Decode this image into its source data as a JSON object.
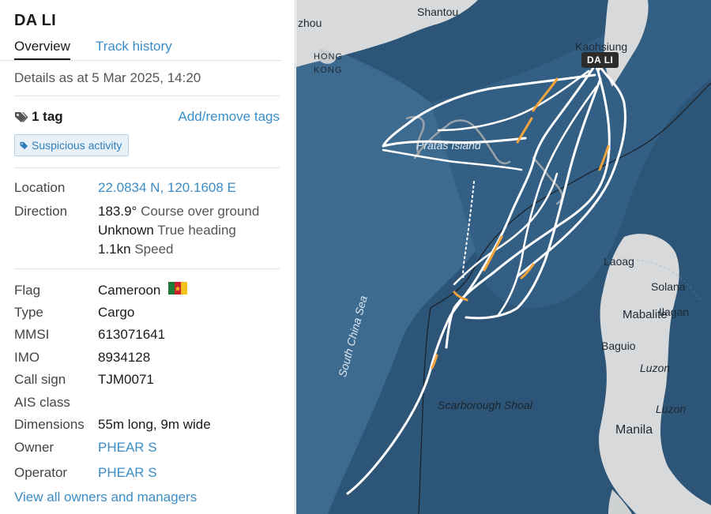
{
  "vessel": {
    "name": "DA LI"
  },
  "tabs": {
    "overview": "Overview",
    "track_history": "Track history"
  },
  "details_time": "Details as at 5 Mar 2025, 14:20",
  "tags": {
    "count_label": "1 tag",
    "add_remove_label": "Add/remove tags",
    "items": [
      "Suspicious activity"
    ]
  },
  "position": {
    "location_label": "Location",
    "location_value": "22.0834 N, 120.1608 E",
    "direction_label": "Direction",
    "course_value": "183.9°",
    "course_label": "Course over ground",
    "heading_value": "Unknown",
    "heading_label": "True heading",
    "speed_value": "1.1kn",
    "speed_label": "Speed"
  },
  "info": {
    "flag_label": "Flag",
    "flag_value": "Cameroon",
    "type_label": "Type",
    "type_value": "Cargo",
    "mmsi_label": "MMSI",
    "mmsi_value": "613071641",
    "imo_label": "IMO",
    "imo_value": "8934128",
    "callsign_label": "Call sign",
    "callsign_value": "TJM0071",
    "ais_label": "AIS class",
    "ais_value": "",
    "dimensions_label": "Dimensions",
    "dimensions_value": "55m long, 9m wide",
    "owner_label": "Owner",
    "owner_value": "PHEAR S",
    "operator_label": "Operator",
    "operator_value": "PHEAR S"
  },
  "view_all_label": "View all owners and managers",
  "map": {
    "ship_label": "DA LI",
    "labels": {
      "shantou": "Shantou",
      "zhou": "zhou",
      "hong": "HONG",
      "kong": "KONG",
      "kaohsiung": "Kaohsiung",
      "pratas": "Pratas Island",
      "south_china_sea": "South China Sea",
      "scarborough": "Scarborough Shoal",
      "laoag": "Laoag",
      "solana": "Solana",
      "mabalite": "Mabalite",
      "ilagan": "Ilagan",
      "baguio": "Baguio",
      "luzon1": "Luzon",
      "luzon2": "Luzon",
      "manila": "Manila"
    },
    "colors": {
      "ocean_deep": "#2c5577",
      "ocean_shelf": "#3d6a8f",
      "land": "#d7d9da",
      "track": "#ffffff",
      "track_slow": "#f3a43a",
      "track_gap": "#9aa3aa"
    }
  },
  "colors": {
    "link": "#3a8dc7",
    "flag_green": "#1f7a3a",
    "flag_red": "#c8202c",
    "flag_yellow": "#f2c21b"
  }
}
